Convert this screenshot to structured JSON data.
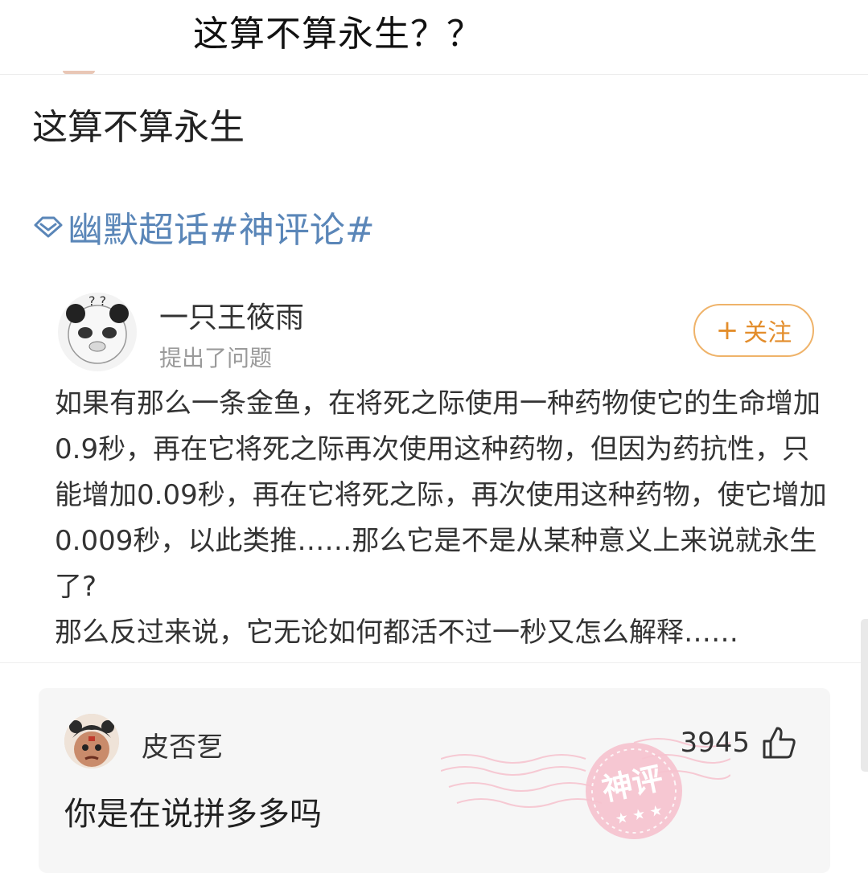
{
  "header": {
    "title": "这算不算永生？？"
  },
  "post": {
    "title": "这算不算永生",
    "topic": "幽默超话#神评论#",
    "author": {
      "name": "一只王筱雨",
      "subtitle": "提出了问题"
    },
    "follow_label": "关注",
    "follow_plus": "+",
    "paragraphs": [
      "如果有那么一条金鱼，在将死之际使用一种药物使它的生命增加0.9秒，再在它将死之际再次使用这种药物，但因为药抗性，只能增加0.09秒，再在它将死之际，再次使用这种药物，使它增加0.009秒，以此类推……那么它是不是从某种意义上来说就永生了?",
      "那么反过来说，它无论如何都活不过一秒又怎么解释……"
    ]
  },
  "comment": {
    "author": "皮否乭",
    "likes": "3945",
    "text": "你是在说拼多多吗",
    "stamp_text": "神评"
  },
  "colors": {
    "topic_blue": "#5a86b8",
    "follow_orange": "#e38d2b",
    "stamp_pink": "#f4b8c6"
  }
}
